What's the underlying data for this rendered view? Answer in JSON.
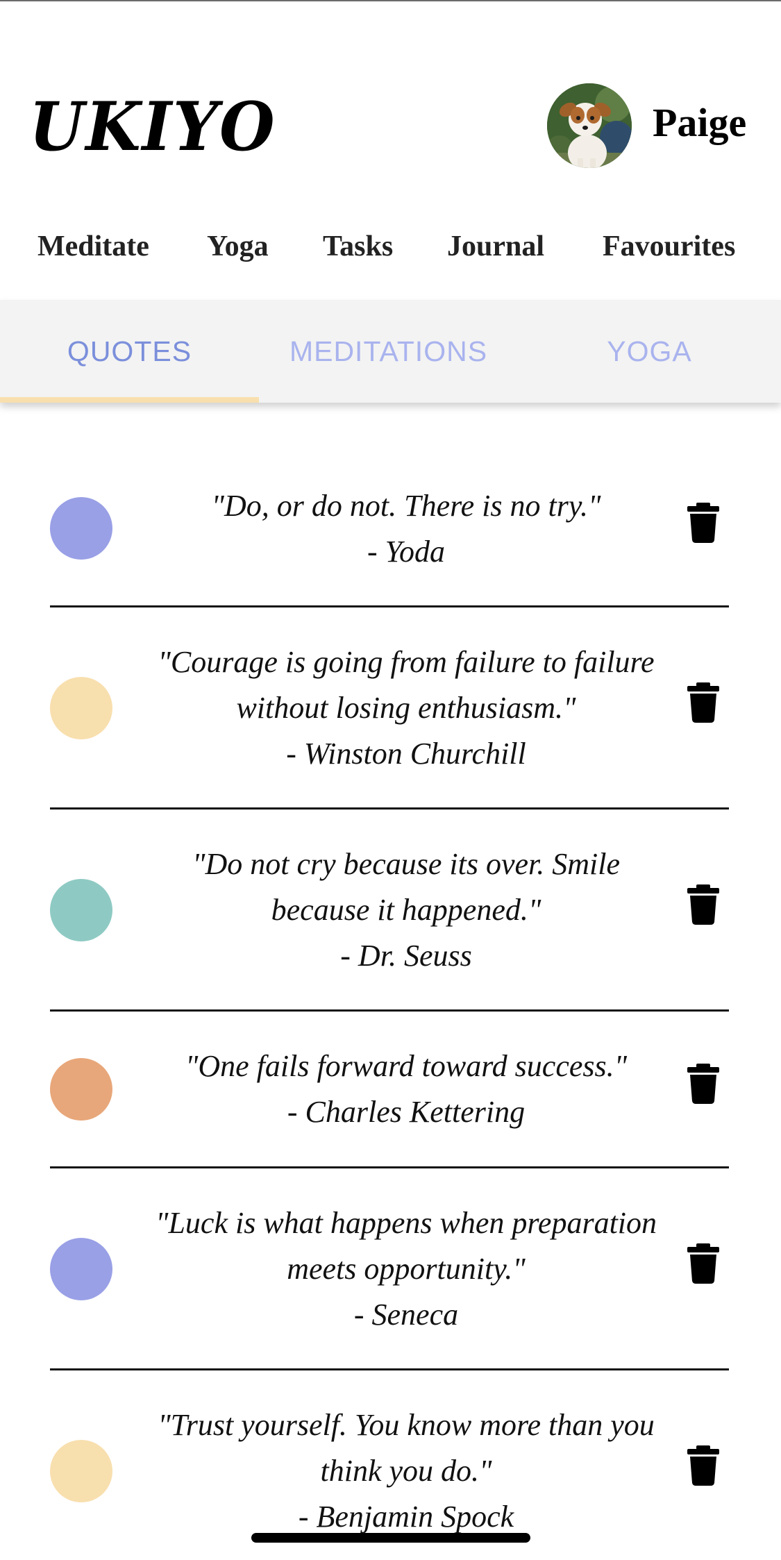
{
  "app": {
    "logo": "UKIYO",
    "user_name": "Paige"
  },
  "nav": [
    "Meditate",
    "Yoga",
    "Tasks",
    "Journal",
    "Favourites"
  ],
  "sub_tabs": {
    "items": [
      "QUOTES",
      "MEDITATIONS",
      "YOGA"
    ],
    "selected": "QUOTES",
    "colors": {
      "selected_text": "#7b8fdb",
      "unselected_text": "#a9b3ee",
      "indicator": "#f8dfae",
      "background": "#f3f3f3"
    }
  },
  "quotes": [
    {
      "lines": [
        "\"Do, or do not. There is no try.\"",
        "- Yoda"
      ],
      "color": "#99a0e6"
    },
    {
      "lines": [
        "\"Courage is going from failure to failure",
        "without losing enthusiasm.\"",
        "- Winston Churchill"
      ],
      "color": "#f8dfae"
    },
    {
      "lines": [
        "\"Do not cry because its over. Smile",
        "because it happened.\"",
        "- Dr. Seuss"
      ],
      "color": "#8ecac3"
    },
    {
      "lines": [
        "\"One fails forward toward success.\"",
        "- Charles Kettering"
      ],
      "color": "#e8a77a"
    },
    {
      "lines": [
        "\"Luck is what happens when preparation",
        "meets opportunity.\"",
        "- Seneca"
      ],
      "color": "#99a0e6"
    },
    {
      "lines": [
        "\"Trust yourself. You know more than you",
        "think you do.\"",
        "- Benjamin Spock"
      ],
      "color": "#f8dfae"
    }
  ],
  "icons": {
    "delete": "trash-icon",
    "avatar": "dog-photo"
  }
}
